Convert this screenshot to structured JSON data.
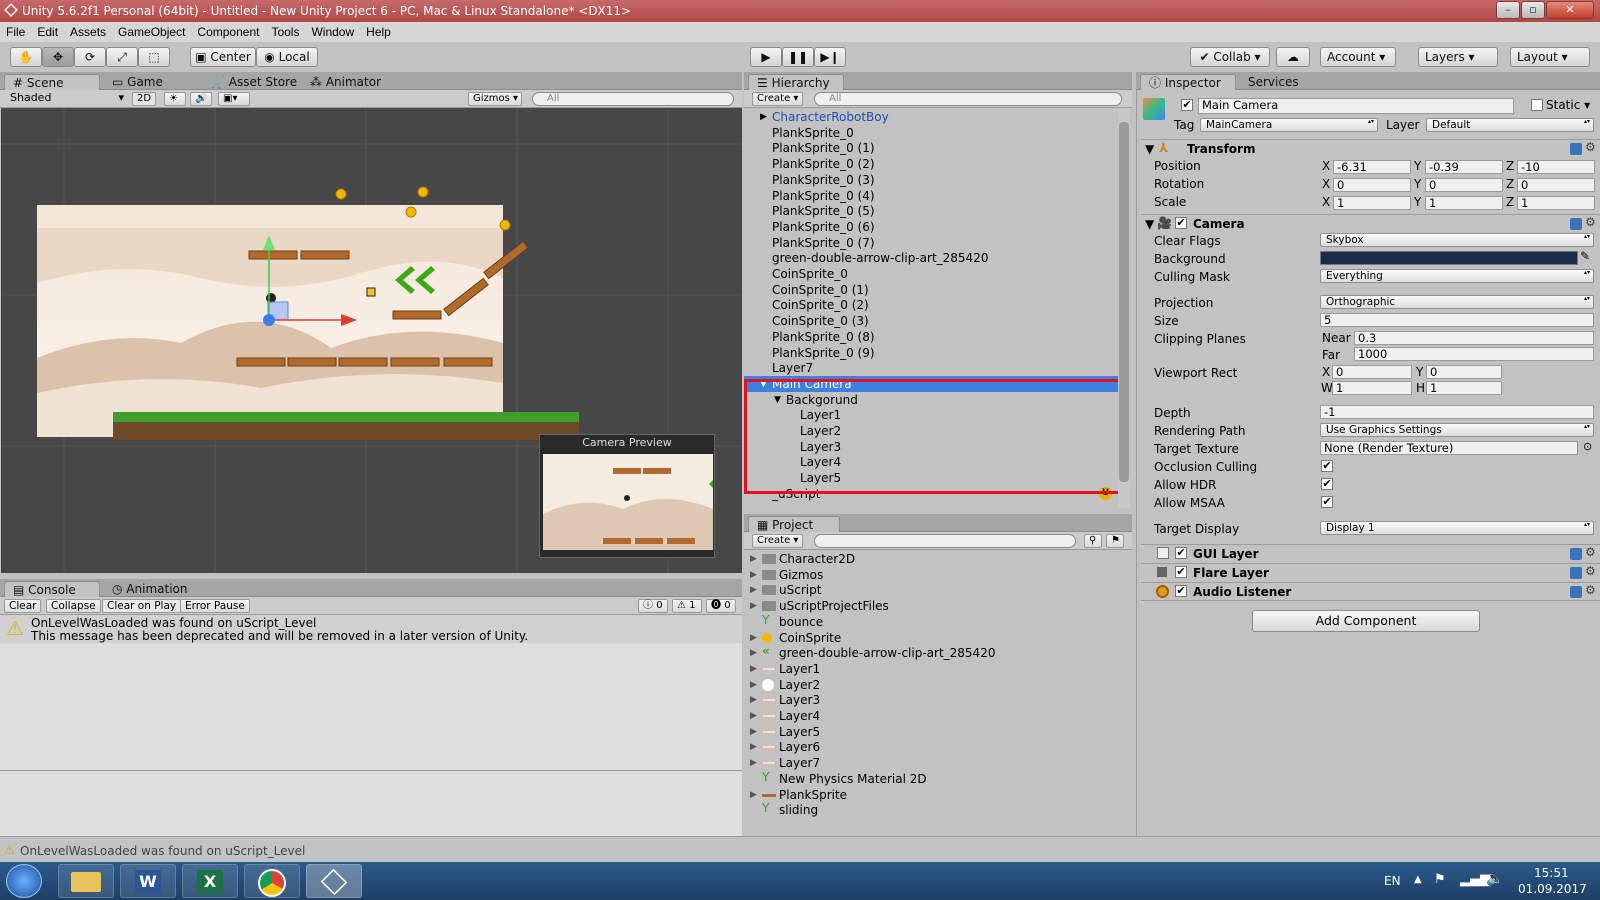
{
  "window": {
    "title": "Unity 5.6.2f1 Personal (64bit) - Untitled - New Unity Project 6 - PC, Mac & Linux Standalone* <DX11>"
  },
  "menu": [
    "File",
    "Edit",
    "Assets",
    "GameObject",
    "Component",
    "Tools",
    "Window",
    "Help"
  ],
  "toolbar": {
    "center": "Center",
    "local": "Local",
    "collab": "Collab",
    "account": "Account",
    "layers": "Layers",
    "layout": "Layout"
  },
  "scene_tabs": {
    "scene": "Scene",
    "game": "Game",
    "asset_store": "Asset Store",
    "animator": "Animator"
  },
  "scene_bar": {
    "shading": "Shaded",
    "mode2d": "2D",
    "gizmos": "Gizmos",
    "search": "All"
  },
  "camera_preview": {
    "title": "Camera Preview"
  },
  "hierarchy": {
    "tab": "Hierarchy",
    "create": "Create",
    "search": "All",
    "items": [
      {
        "label": "CharacterRobotBoy",
        "indent": 0,
        "arrow": "▶",
        "style": "prefab"
      },
      {
        "label": "PlankSprite_0",
        "indent": 0
      },
      {
        "label": "PlankSprite_0 (1)",
        "indent": 0
      },
      {
        "label": "PlankSprite_0 (2)",
        "indent": 0
      },
      {
        "label": "PlankSprite_0 (3)",
        "indent": 0
      },
      {
        "label": "PlankSprite_0 (4)",
        "indent": 0
      },
      {
        "label": "PlankSprite_0 (5)",
        "indent": 0
      },
      {
        "label": "PlankSprite_0 (6)",
        "indent": 0
      },
      {
        "label": "PlankSprite_0 (7)",
        "indent": 0
      },
      {
        "label": "green-double-arrow-clip-art_285420",
        "indent": 0
      },
      {
        "label": "CoinSprite_0",
        "indent": 0
      },
      {
        "label": "CoinSprite_0 (1)",
        "indent": 0
      },
      {
        "label": "CoinSprite_0 (2)",
        "indent": 0
      },
      {
        "label": "CoinSprite_0 (3)",
        "indent": 0
      },
      {
        "label": "PlankSprite_0 (8)",
        "indent": 0
      },
      {
        "label": "PlankSprite_0 (9)",
        "indent": 0
      },
      {
        "label": "Layer7",
        "indent": 0
      },
      {
        "label": "Main Camera",
        "indent": 0,
        "arrow": "▼",
        "style": "selected"
      },
      {
        "label": "Backgorund",
        "indent": 1,
        "arrow": "▼"
      },
      {
        "label": "Layer1",
        "indent": 2
      },
      {
        "label": "Layer2",
        "indent": 2
      },
      {
        "label": "Layer3",
        "indent": 2
      },
      {
        "label": "Layer4",
        "indent": 2
      },
      {
        "label": "Layer5",
        "indent": 2
      },
      {
        "label": "_uScript",
        "indent": 0
      }
    ]
  },
  "project": {
    "tab": "Project",
    "create": "Create",
    "items": [
      {
        "label": "Character2D",
        "icon": "folder",
        "arrow": true
      },
      {
        "label": "Gizmos",
        "icon": "folder",
        "arrow": true
      },
      {
        "label": "uScript",
        "icon": "folder",
        "arrow": true
      },
      {
        "label": "uScriptProjectFiles",
        "icon": "folder",
        "arrow": true
      },
      {
        "label": "bounce",
        "icon": "physics",
        "arrow": false
      },
      {
        "label": "CoinSprite",
        "icon": "coin",
        "arrow": true
      },
      {
        "label": "green-double-arrow-clip-art_285420",
        "icon": "arrow",
        "arrow": true
      },
      {
        "label": "Layer1",
        "icon": "sprite",
        "arrow": true
      },
      {
        "label": "Layer2",
        "icon": "sprite-round",
        "arrow": true
      },
      {
        "label": "Layer3",
        "icon": "sprite",
        "arrow": true
      },
      {
        "label": "Layer4",
        "icon": "sprite",
        "arrow": true
      },
      {
        "label": "Layer5",
        "icon": "sprite",
        "arrow": true
      },
      {
        "label": "Layer6",
        "icon": "sprite",
        "arrow": true
      },
      {
        "label": "Layer7",
        "icon": "sprite",
        "arrow": true
      },
      {
        "label": "New Physics Material 2D",
        "icon": "physics",
        "arrow": false
      },
      {
        "label": "PlankSprite",
        "icon": "plank",
        "arrow": true
      },
      {
        "label": "sliding",
        "icon": "physics",
        "arrow": false
      }
    ]
  },
  "console": {
    "tab": "Console",
    "tab2": "Animation",
    "buttons": {
      "clear": "Clear",
      "collapse": "Collapse",
      "clear_on_play": "Clear on Play",
      "error_pause": "Error Pause"
    },
    "counts": {
      "info": "0",
      "warn": "1",
      "error": "0"
    },
    "message1": "OnLevelWasLoaded was found on uScript_Level",
    "message2": "This message has been deprecated and will be removed in a later version of Unity.",
    "status": "OnLevelWasLoaded was found on uScript_Level"
  },
  "inspector": {
    "tab": "Inspector",
    "tab2": "Services",
    "name": "Main Camera",
    "static": "Static",
    "tag_label": "Tag",
    "tag": "MainCamera",
    "layer_label": "Layer",
    "layer": "Default",
    "transform": {
      "title": "Transform",
      "position": "Position",
      "rotation": "Rotation",
      "scale": "Scale",
      "pos": [
        "-6.31",
        "-0.39",
        "-10"
      ],
      "rot": [
        "0",
        "0",
        "0"
      ],
      "scl": [
        "1",
        "1",
        "1"
      ]
    },
    "camera": {
      "title": "Camera",
      "clear_flags_label": "Clear Flags",
      "clear_flags": "Skybox",
      "background_label": "Background",
      "background_color": "#1b2b4a",
      "culling_mask_label": "Culling Mask",
      "culling_mask": "Everything",
      "projection_label": "Projection",
      "projection": "Orthographic",
      "size_label": "Size",
      "size": "5",
      "clipping_label": "Clipping Planes",
      "near_label": "Near",
      "near": "0.3",
      "far_label": "Far",
      "far": "1000",
      "viewport_label": "Viewport Rect",
      "vx": "0",
      "vy": "0",
      "vw": "1",
      "vh": "1",
      "depth_label": "Depth",
      "depth": "-1",
      "rendering_path_label": "Rendering Path",
      "rendering_path": "Use Graphics Settings",
      "target_texture_label": "Target Texture",
      "target_texture": "None (Render Texture)",
      "occlusion_label": "Occlusion Culling",
      "hdr_label": "Allow HDR",
      "msaa_label": "Allow MSAA",
      "target_display_label": "Target Display",
      "target_display": "Display 1"
    },
    "gui_layer": "GUI Layer",
    "flare_layer": "Flare Layer",
    "audio_listener": "Audio Listener",
    "add_component": "Add Component"
  },
  "taskbar": {
    "lang": "EN",
    "time": "15:51",
    "date": "01.09.2017"
  }
}
